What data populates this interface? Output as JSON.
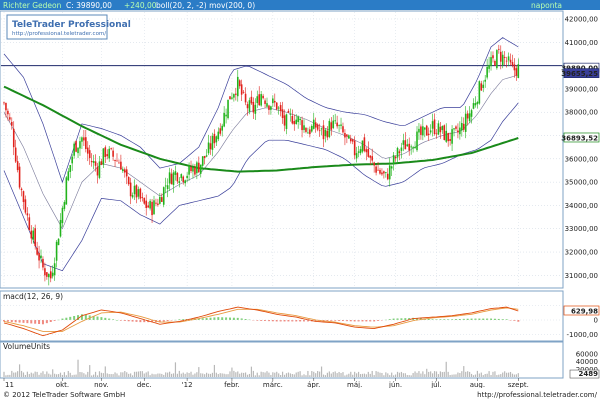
{
  "header": {
    "instrument": "Richter Gedeon",
    "quote": "C: 39890,00",
    "change": "+240,00",
    "indicators": "boll(20, 2, -2) mov(200, 0)",
    "period": "naponta"
  },
  "brand": {
    "name": "TeleTrader Professional",
    "url": "http://professional.teletrader.com/"
  },
  "footer": {
    "copyright": "© 2012 TeleTrader Software GmbH",
    "url": "http://professional.teletrader.com/"
  },
  "colors": {
    "up_candle": "#22b31c",
    "down_candle": "#e0211b",
    "bollinger": "#3a3f9a",
    "moving_average": "#1a8a1a",
    "macd_line": "#e04a0a",
    "signal_line": "#e89a40",
    "header_bg": "#2b7cc6"
  },
  "chart_data": [
    {
      "type": "candlestick",
      "panel": "price",
      "y_range": [
        30500,
        42300
      ],
      "y_ticks": [
        "42000,00",
        "41000,00",
        "40000,00",
        "39000,00",
        "38000,00",
        "37000,00",
        "36000,00",
        "35000,00",
        "34000,00",
        "33000,00",
        "32000,00",
        "31000,00"
      ],
      "y_tick_values": [
        42000,
        41000,
        40000,
        39000,
        38000,
        37000,
        36000,
        35000,
        34000,
        33000,
        32000,
        31000
      ],
      "price_labels": [
        {
          "text": "39890,00",
          "value": 39890
        },
        {
          "text": "39655,25",
          "value": 39655
        },
        {
          "text": "36893,52",
          "value": 36894
        }
      ],
      "horizontal_line": 40000,
      "x_labels": [
        "11",
        "okt.",
        "nov.",
        "dec.",
        "'12",
        "febr.",
        "márc.",
        "ápr.",
        "máj.",
        "jún.",
        "júl.",
        "aug.",
        "szept."
      ],
      "x_label_positions": [
        0,
        30,
        50,
        72,
        94,
        117,
        138,
        159,
        180,
        201,
        222,
        243,
        264
      ],
      "x_count": 270,
      "closes": [
        {
          "i": 0,
          "v": 38400
        },
        {
          "i": 4,
          "v": 37300
        },
        {
          "i": 8,
          "v": 35000
        },
        {
          "i": 12,
          "v": 33500
        },
        {
          "i": 16,
          "v": 32300
        },
        {
          "i": 20,
          "v": 31300
        },
        {
          "i": 24,
          "v": 30900
        },
        {
          "i": 28,
          "v": 32800
        },
        {
          "i": 32,
          "v": 35000
        },
        {
          "i": 36,
          "v": 36500
        },
        {
          "i": 40,
          "v": 36900
        },
        {
          "i": 44,
          "v": 36000
        },
        {
          "i": 48,
          "v": 35600
        },
        {
          "i": 52,
          "v": 36300
        },
        {
          "i": 56,
          "v": 36100
        },
        {
          "i": 60,
          "v": 35800
        },
        {
          "i": 64,
          "v": 34700
        },
        {
          "i": 68,
          "v": 34500
        },
        {
          "i": 72,
          "v": 34000
        },
        {
          "i": 76,
          "v": 33900
        },
        {
          "i": 80,
          "v": 34300
        },
        {
          "i": 84,
          "v": 35100
        },
        {
          "i": 88,
          "v": 35400
        },
        {
          "i": 92,
          "v": 35300
        },
        {
          "i": 96,
          "v": 35500
        },
        {
          "i": 100,
          "v": 35700
        },
        {
          "i": 104,
          "v": 36200
        },
        {
          "i": 108,
          "v": 36900
        },
        {
          "i": 112,
          "v": 37600
        },
        {
          "i": 116,
          "v": 38700
        },
        {
          "i": 120,
          "v": 39200
        },
        {
          "i": 124,
          "v": 38300
        },
        {
          "i": 128,
          "v": 38100
        },
        {
          "i": 132,
          "v": 38800
        },
        {
          "i": 136,
          "v": 38400
        },
        {
          "i": 140,
          "v": 38300
        },
        {
          "i": 144,
          "v": 37500
        },
        {
          "i": 148,
          "v": 37800
        },
        {
          "i": 152,
          "v": 37600
        },
        {
          "i": 156,
          "v": 37200
        },
        {
          "i": 160,
          "v": 37400
        },
        {
          "i": 164,
          "v": 37000
        },
        {
          "i": 168,
          "v": 37500
        },
        {
          "i": 172,
          "v": 37300
        },
        {
          "i": 176,
          "v": 36800
        },
        {
          "i": 180,
          "v": 36300
        },
        {
          "i": 184,
          "v": 36700
        },
        {
          "i": 188,
          "v": 35900
        },
        {
          "i": 192,
          "v": 35500
        },
        {
          "i": 196,
          "v": 35200
        },
        {
          "i": 200,
          "v": 35900
        },
        {
          "i": 204,
          "v": 36500
        },
        {
          "i": 208,
          "v": 36700
        },
        {
          "i": 212,
          "v": 36900
        },
        {
          "i": 216,
          "v": 37100
        },
        {
          "i": 220,
          "v": 37400
        },
        {
          "i": 224,
          "v": 37200
        },
        {
          "i": 228,
          "v": 36900
        },
        {
          "i": 232,
          "v": 37000
        },
        {
          "i": 236,
          "v": 37500
        },
        {
          "i": 240,
          "v": 38100
        },
        {
          "i": 244,
          "v": 39000
        },
        {
          "i": 248,
          "v": 39800
        },
        {
          "i": 252,
          "v": 40300
        },
        {
          "i": 254,
          "v": 40500
        },
        {
          "i": 258,
          "v": 40200
        },
        {
          "i": 261,
          "v": 39800
        },
        {
          "i": 264,
          "v": 39890
        }
      ],
      "bollinger_upper": [
        {
          "i": 0,
          "v": 40500
        },
        {
          "i": 10,
          "v": 39500
        },
        {
          "i": 20,
          "v": 37500
        },
        {
          "i": 30,
          "v": 35000
        },
        {
          "i": 40,
          "v": 37500
        },
        {
          "i": 50,
          "v": 37300
        },
        {
          "i": 60,
          "v": 37000
        },
        {
          "i": 70,
          "v": 36500
        },
        {
          "i": 80,
          "v": 35600
        },
        {
          "i": 90,
          "v": 35800
        },
        {
          "i": 100,
          "v": 36500
        },
        {
          "i": 110,
          "v": 38200
        },
        {
          "i": 117,
          "v": 39800
        },
        {
          "i": 125,
          "v": 40000
        },
        {
          "i": 135,
          "v": 39600
        },
        {
          "i": 145,
          "v": 39200
        },
        {
          "i": 155,
          "v": 38600
        },
        {
          "i": 165,
          "v": 38200
        },
        {
          "i": 175,
          "v": 38000
        },
        {
          "i": 185,
          "v": 37900
        },
        {
          "i": 195,
          "v": 37600
        },
        {
          "i": 205,
          "v": 37400
        },
        {
          "i": 215,
          "v": 37800
        },
        {
          "i": 225,
          "v": 38200
        },
        {
          "i": 235,
          "v": 38200
        },
        {
          "i": 243,
          "v": 39400
        },
        {
          "i": 250,
          "v": 40800
        },
        {
          "i": 256,
          "v": 41200
        },
        {
          "i": 264,
          "v": 40800
        }
      ],
      "bollinger_middle": [
        {
          "i": 0,
          "v": 38000
        },
        {
          "i": 10,
          "v": 36500
        },
        {
          "i": 20,
          "v": 34500
        },
        {
          "i": 30,
          "v": 33000
        },
        {
          "i": 40,
          "v": 35000
        },
        {
          "i": 50,
          "v": 35800
        },
        {
          "i": 60,
          "v": 35600
        },
        {
          "i": 70,
          "v": 35000
        },
        {
          "i": 80,
          "v": 34400
        },
        {
          "i": 90,
          "v": 34900
        },
        {
          "i": 100,
          "v": 35300
        },
        {
          "i": 110,
          "v": 36300
        },
        {
          "i": 117,
          "v": 37200
        },
        {
          "i": 125,
          "v": 38000
        },
        {
          "i": 135,
          "v": 38200
        },
        {
          "i": 145,
          "v": 38000
        },
        {
          "i": 155,
          "v": 37700
        },
        {
          "i": 165,
          "v": 37300
        },
        {
          "i": 175,
          "v": 37000
        },
        {
          "i": 185,
          "v": 36600
        },
        {
          "i": 195,
          "v": 36000
        },
        {
          "i": 205,
          "v": 36200
        },
        {
          "i": 215,
          "v": 36700
        },
        {
          "i": 225,
          "v": 37000
        },
        {
          "i": 235,
          "v": 37200
        },
        {
          "i": 243,
          "v": 37900
        },
        {
          "i": 250,
          "v": 38800
        },
        {
          "i": 256,
          "v": 39400
        },
        {
          "i": 264,
          "v": 39600
        }
      ],
      "bollinger_lower": [
        {
          "i": 0,
          "v": 35500
        },
        {
          "i": 10,
          "v": 33500
        },
        {
          "i": 20,
          "v": 31500
        },
        {
          "i": 30,
          "v": 31200
        },
        {
          "i": 40,
          "v": 32500
        },
        {
          "i": 50,
          "v": 34300
        },
        {
          "i": 60,
          "v": 34200
        },
        {
          "i": 70,
          "v": 33600
        },
        {
          "i": 80,
          "v": 33200
        },
        {
          "i": 90,
          "v": 34000
        },
        {
          "i": 100,
          "v": 34200
        },
        {
          "i": 110,
          "v": 34400
        },
        {
          "i": 117,
          "v": 34800
        },
        {
          "i": 125,
          "v": 36000
        },
        {
          "i": 135,
          "v": 36800
        },
        {
          "i": 145,
          "v": 36800
        },
        {
          "i": 155,
          "v": 36600
        },
        {
          "i": 165,
          "v": 36400
        },
        {
          "i": 175,
          "v": 36000
        },
        {
          "i": 185,
          "v": 35300
        },
        {
          "i": 195,
          "v": 34800
        },
        {
          "i": 205,
          "v": 35000
        },
        {
          "i": 215,
          "v": 35600
        },
        {
          "i": 225,
          "v": 35800
        },
        {
          "i": 235,
          "v": 36200
        },
        {
          "i": 243,
          "v": 36400
        },
        {
          "i": 250,
          "v": 36800
        },
        {
          "i": 256,
          "v": 37600
        },
        {
          "i": 264,
          "v": 38400
        }
      ],
      "moving_average_200": [
        {
          "i": 0,
          "v": 39100
        },
        {
          "i": 20,
          "v": 38300
        },
        {
          "i": 40,
          "v": 37400
        },
        {
          "i": 60,
          "v": 36600
        },
        {
          "i": 80,
          "v": 36000
        },
        {
          "i": 100,
          "v": 35600
        },
        {
          "i": 120,
          "v": 35450
        },
        {
          "i": 140,
          "v": 35500
        },
        {
          "i": 160,
          "v": 35650
        },
        {
          "i": 180,
          "v": 35750
        },
        {
          "i": 200,
          "v": 35800
        },
        {
          "i": 220,
          "v": 35950
        },
        {
          "i": 240,
          "v": 36250
        },
        {
          "i": 255,
          "v": 36650
        },
        {
          "i": 264,
          "v": 36893
        }
      ]
    },
    {
      "type": "line",
      "panel": "macd",
      "label": "macd(12, 26, 9)",
      "y_range": [
        -1400,
        1400
      ],
      "y_ticks": [
        "1000,00",
        "0",
        "-1000,00"
      ],
      "y_tick_values": [
        1000,
        0,
        -1000
      ],
      "value_label": {
        "text": "629,98",
        "value": 630
      },
      "macd_line": [
        {
          "i": 0,
          "v": -200
        },
        {
          "i": 10,
          "v": -600
        },
        {
          "i": 20,
          "v": -1100
        },
        {
          "i": 30,
          "v": -700
        },
        {
          "i": 40,
          "v": 300
        },
        {
          "i": 50,
          "v": 700
        },
        {
          "i": 60,
          "v": 500
        },
        {
          "i": 70,
          "v": 100
        },
        {
          "i": 80,
          "v": -300
        },
        {
          "i": 90,
          "v": -100
        },
        {
          "i": 100,
          "v": 200
        },
        {
          "i": 110,
          "v": 600
        },
        {
          "i": 120,
          "v": 900
        },
        {
          "i": 130,
          "v": 700
        },
        {
          "i": 140,
          "v": 400
        },
        {
          "i": 150,
          "v": 200
        },
        {
          "i": 160,
          "v": -100
        },
        {
          "i": 170,
          "v": -200
        },
        {
          "i": 180,
          "v": -500
        },
        {
          "i": 190,
          "v": -600
        },
        {
          "i": 200,
          "v": -300
        },
        {
          "i": 210,
          "v": 100
        },
        {
          "i": 220,
          "v": 200
        },
        {
          "i": 230,
          "v": 300
        },
        {
          "i": 240,
          "v": 500
        },
        {
          "i": 250,
          "v": 800
        },
        {
          "i": 258,
          "v": 900
        },
        {
          "i": 264,
          "v": 630
        }
      ],
      "signal_line": [
        {
          "i": 0,
          "v": -100
        },
        {
          "i": 10,
          "v": -400
        },
        {
          "i": 20,
          "v": -800
        },
        {
          "i": 30,
          "v": -800
        },
        {
          "i": 40,
          "v": -100
        },
        {
          "i": 50,
          "v": 500
        },
        {
          "i": 60,
          "v": 550
        },
        {
          "i": 70,
          "v": 250
        },
        {
          "i": 80,
          "v": -150
        },
        {
          "i": 90,
          "v": -150
        },
        {
          "i": 100,
          "v": 100
        },
        {
          "i": 110,
          "v": 400
        },
        {
          "i": 120,
          "v": 750
        },
        {
          "i": 130,
          "v": 750
        },
        {
          "i": 140,
          "v": 500
        },
        {
          "i": 150,
          "v": 300
        },
        {
          "i": 160,
          "v": 0
        },
        {
          "i": 170,
          "v": -150
        },
        {
          "i": 180,
          "v": -400
        },
        {
          "i": 190,
          "v": -500
        },
        {
          "i": 200,
          "v": -400
        },
        {
          "i": 210,
          "v": -50
        },
        {
          "i": 220,
          "v": 150
        },
        {
          "i": 230,
          "v": 250
        },
        {
          "i": 240,
          "v": 400
        },
        {
          "i": 250,
          "v": 700
        },
        {
          "i": 258,
          "v": 850
        },
        {
          "i": 264,
          "v": 750
        }
      ]
    },
    {
      "type": "bar",
      "panel": "volume",
      "label": "VolumeUnits",
      "y_range": [
        0,
        70000
      ],
      "y_ticks": [
        "60000",
        "40000",
        "20000"
      ],
      "y_tick_values": [
        60000,
        40000,
        20000
      ],
      "value_label": {
        "text": "2489",
        "value": 2489
      }
    }
  ]
}
